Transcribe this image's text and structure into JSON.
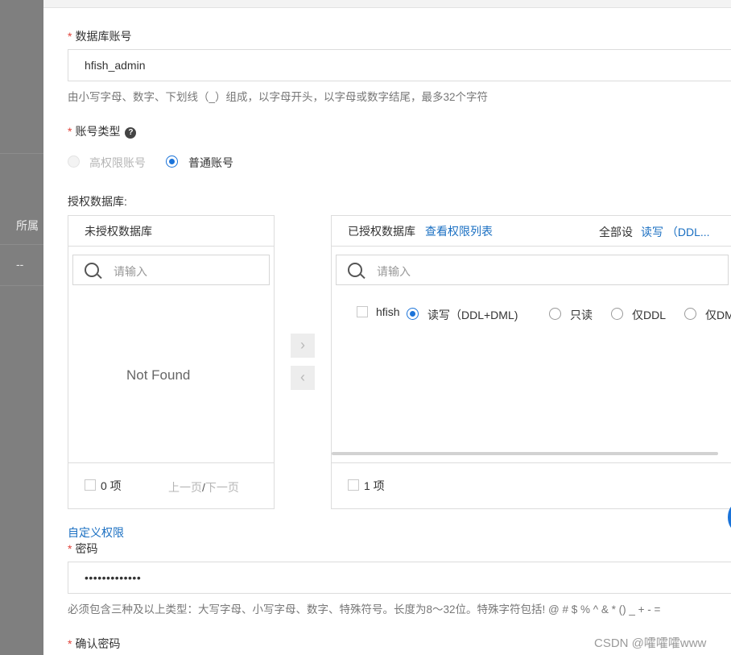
{
  "background": {
    "row_label": "所属",
    "row_value": "--"
  },
  "account": {
    "required_mark": "*",
    "label": "数据库账号",
    "value": "hfish_admin",
    "hint": "由小写字母、数字、下划线（_）组成，以字母开头，以字母或数字结尾，最多32个字符"
  },
  "account_type": {
    "required_mark": "*",
    "label": "账号类型",
    "help_icon": "question-circle-icon",
    "options": [
      {
        "label": "高权限账号",
        "state": "disabled"
      },
      {
        "label": "普通账号",
        "state": "checked"
      }
    ]
  },
  "authorize": {
    "label": "授权数据库:",
    "left": {
      "title": "未授权数据库",
      "search_placeholder": "请输入",
      "empty_text": "Not Found",
      "count": "0 项",
      "prev": "上一页",
      "sep": "/",
      "next": "下一页"
    },
    "buttons": {
      "move_right": "›",
      "move_left": "‹"
    },
    "right": {
      "title": "已授权数据库",
      "perm_link": "查看权限列表",
      "set_all_label": "全部设",
      "set_all_link": "读写 （DDL...",
      "search_placeholder": "请输入",
      "row": {
        "name": "hfish",
        "options": [
          {
            "label": "读写（DDL+DML)",
            "checked": true
          },
          {
            "label": "只读",
            "checked": false
          },
          {
            "label": "仅DDL",
            "checked": false
          },
          {
            "label": "仅DM",
            "checked": false
          }
        ]
      },
      "count": "1 项"
    }
  },
  "custom_permission": "自定义权限",
  "password": {
    "required_mark": "*",
    "label": "密码",
    "value": "•••••••••••••",
    "hint": "必须包含三种及以上类型：大写字母、小写字母、数字、特殊符号。长度为8～32位。特殊字符包括! @ # $ % ^ & * () _ + - ="
  },
  "confirm_password": {
    "required_mark": "*",
    "label": "确认密码"
  },
  "watermark": "CSDN @嚯嚯嚯www",
  "colors": {
    "accent": "#1a73d9",
    "required": "#e0423a",
    "link": "#1a6fc2"
  }
}
